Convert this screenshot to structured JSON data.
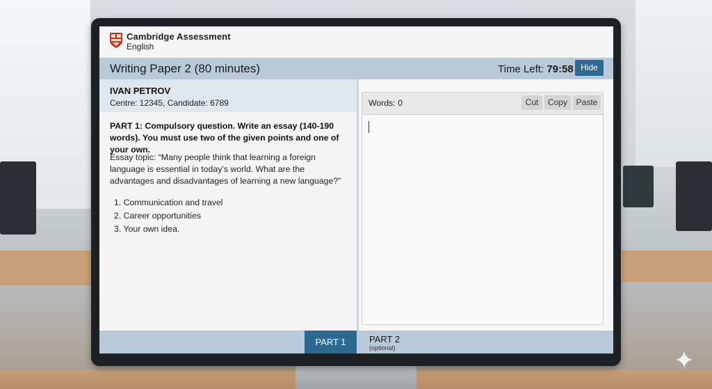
{
  "brand": {
    "line1": "Cambridge Assessment",
    "line2": "English"
  },
  "header": {
    "paper_title": "Writing Paper 2 (80 minutes)",
    "time_left_label": "Time Left:",
    "time_left_value": "79:58",
    "hide_label": "Hide"
  },
  "candidate": {
    "name": "IVAN PETROV",
    "info": "Centre: 12345, Candidate: 6789"
  },
  "task": {
    "instruction": "PART 1: Compulsory question. Write an essay (140-190 words). You must use two of the given points and one of your own.",
    "topic": "Essay topic: “Many people think that learning a foreign language is essential in today’s world. What are the advantages and disadvantages of learning a new language?”",
    "points": [
      "1. Communication and travel",
      "2. Career opportunities",
      "3. Your own idea."
    ]
  },
  "editor": {
    "word_count": "Words: 0",
    "cut_label": "Cut",
    "copy_label": "Copy",
    "paste_label": "Paste",
    "text": ""
  },
  "nav": {
    "part1_label": "PART 1",
    "part2_label": "PART 2",
    "part2_sub": "(optional)"
  },
  "colors": {
    "accent": "#2d6a93",
    "bar": "#b8cad9",
    "candidate_bg": "#dfe7ee"
  }
}
